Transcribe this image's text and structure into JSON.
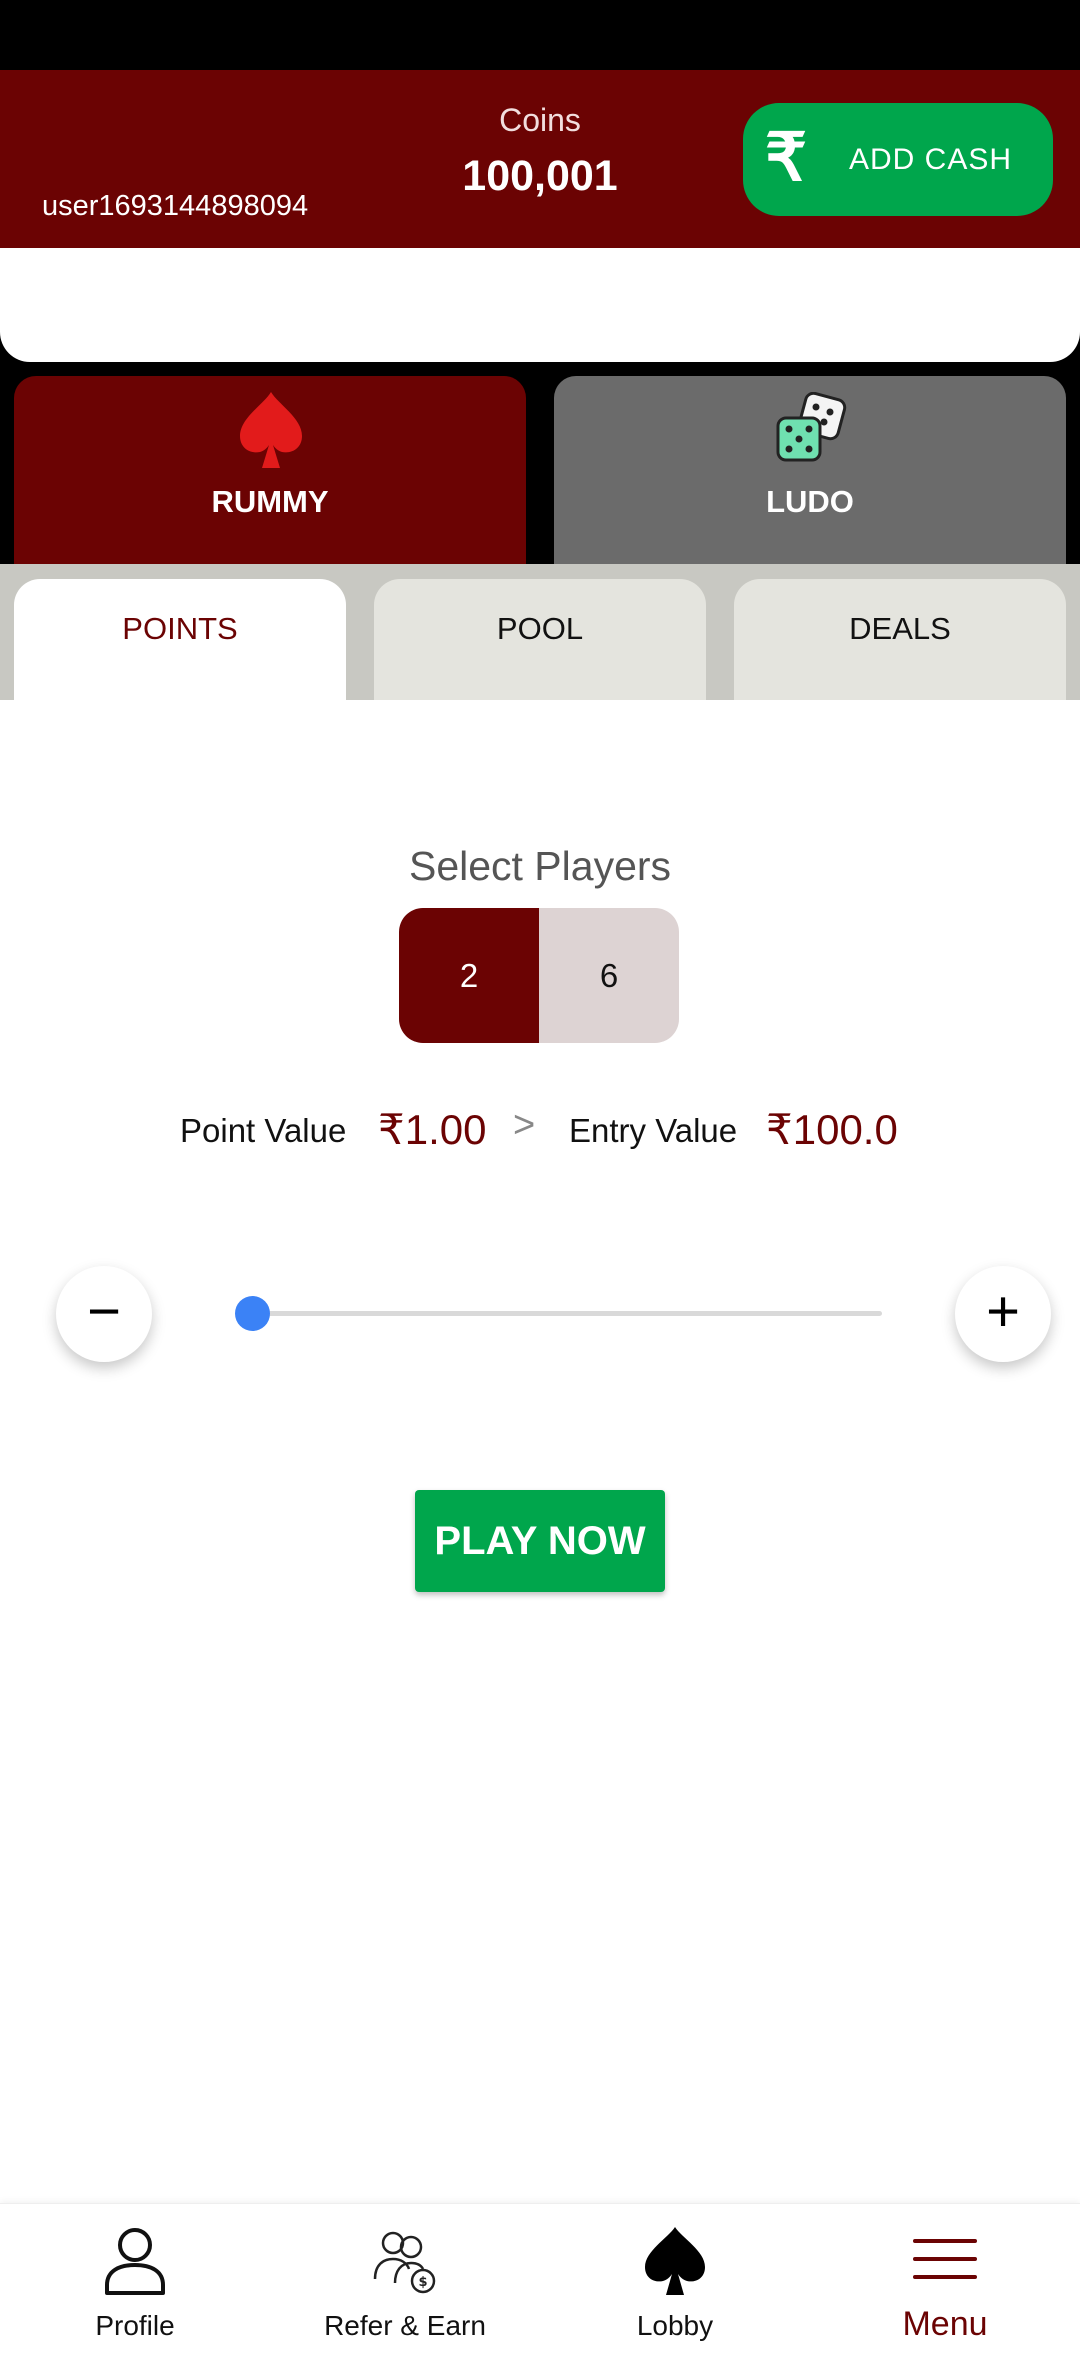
{
  "header": {
    "username": "user1693144898094",
    "coins_label": "Coins",
    "coins_value": "100,001",
    "add_cash_icon": "₹",
    "add_cash_label": "ADD CASH"
  },
  "games": [
    {
      "label": "RUMMY",
      "icon": "spade-icon",
      "selected": true
    },
    {
      "label": "LUDO",
      "icon": "dice-icon",
      "selected": false
    }
  ],
  "tabs": [
    {
      "label": "POINTS",
      "selected": true
    },
    {
      "label": "POOL",
      "selected": false
    },
    {
      "label": "DEALS",
      "selected": false
    }
  ],
  "players": {
    "title": "Select Players",
    "options": [
      "2",
      "6"
    ],
    "selected": "2"
  },
  "values": {
    "point_label": "Point Value",
    "point_value": "₹1.00",
    "separator": ">",
    "entry_label": "Entry Value",
    "entry_value": "₹100.0"
  },
  "slider": {
    "minus": "−",
    "plus": "+",
    "level": 0
  },
  "play_now_label": "PLAY NOW",
  "bottom_nav": [
    {
      "label": "Profile",
      "icon": "profile-icon"
    },
    {
      "label": "Refer & Earn",
      "icon": "refer-earn-icon"
    },
    {
      "label": "Lobby",
      "icon": "spade-icon"
    },
    {
      "label": "Menu",
      "icon": "hamburger-menu-icon",
      "selected": true
    }
  ],
  "colors": {
    "brand": "#6b0303",
    "green": "#00a64c",
    "slider": "#3b82f6"
  }
}
